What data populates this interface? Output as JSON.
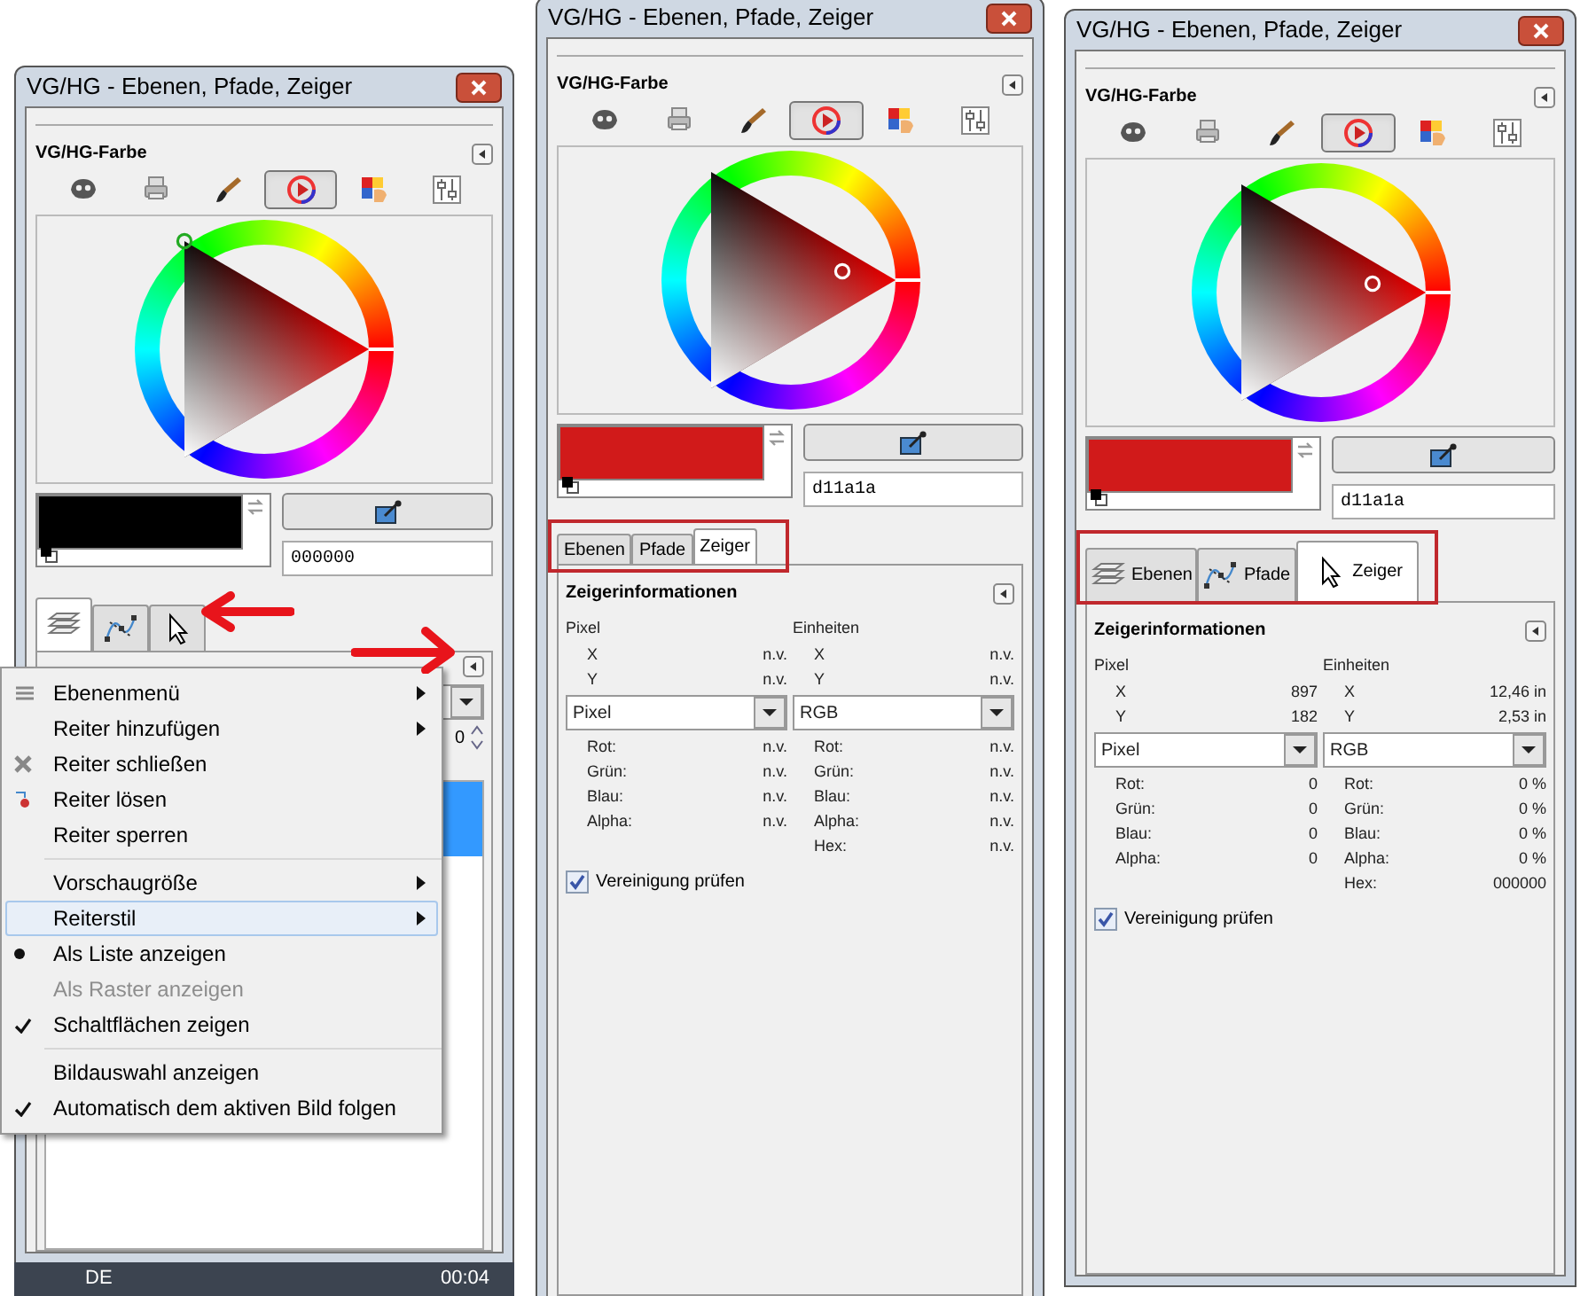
{
  "panels": [
    {
      "title": "VG/HG - Ebenen, Pfade, Zeiger",
      "dock_title": "VG/HG-Farbe",
      "color_modes": [
        {
          "selected": false
        },
        {
          "selected": false
        },
        {
          "selected": false
        },
        {
          "selected": true
        },
        {
          "selected": false
        },
        {
          "selected": false
        }
      ],
      "hex": "000000",
      "tabs": [
        {
          "kind": "icon",
          "selected": true
        },
        {
          "kind": "icon",
          "selected": false
        },
        {
          "kind": "icon",
          "selected": false
        }
      ],
      "annotation_arrows": true,
      "layers_dock": {
        "value": "0"
      },
      "menu": {
        "groups": [
          [
            {
              "label": "Ebenenmenü",
              "kind": "submenu",
              "selected": false,
              "disabled": false
            },
            {
              "label": "Reiter hinzufügen",
              "kind": "submenu",
              "selected": false,
              "disabled": false
            },
            {
              "label": "Reiter schließen",
              "kind": "action",
              "selected": false,
              "disabled": false
            },
            {
              "label": "Reiter lösen",
              "kind": "action",
              "selected": false,
              "disabled": false
            },
            {
              "label": "Reiter sperren",
              "kind": "action",
              "selected": false,
              "disabled": false
            }
          ],
          [
            {
              "label": "Vorschaugröße",
              "kind": "submenu",
              "selected": false,
              "disabled": false
            },
            {
              "label": "Reiterstil",
              "kind": "submenu",
              "selected": true,
              "disabled": false
            },
            {
              "label": "Als Liste anzeigen",
              "kind": "radio",
              "checked": true,
              "selected": false,
              "disabled": false
            },
            {
              "label": "Als Raster anzeigen",
              "kind": "radio",
              "checked": false,
              "selected": false,
              "disabled": true
            },
            {
              "label": "Schaltflächen zeigen",
              "kind": "check",
              "checked": true,
              "selected": false,
              "disabled": false
            }
          ],
          [
            {
              "label": "Bildauswahl anzeigen",
              "kind": "check",
              "checked": false,
              "selected": false,
              "disabled": false
            },
            {
              "label": "Automatisch dem aktiven Bild folgen",
              "kind": "check",
              "checked": true,
              "selected": false,
              "disabled": false
            }
          ]
        ]
      },
      "taskbar": {
        "language": "DE",
        "clock": "00:04"
      }
    },
    {
      "title": "VG/HG - Ebenen, Pfade, Zeiger",
      "dock_title": "VG/HG-Farbe",
      "color_modes": [
        {
          "selected": false
        },
        {
          "selected": false
        },
        {
          "selected": false
        },
        {
          "selected": true
        },
        {
          "selected": false
        },
        {
          "selected": false
        }
      ],
      "hex": "d11a1a",
      "tabs": [
        {
          "kind": "text",
          "label": "Ebenen",
          "selected": false
        },
        {
          "kind": "text",
          "label": "Pfade",
          "selected": false
        },
        {
          "kind": "text",
          "label": "Zeiger",
          "selected": true
        }
      ],
      "tabs_highlighted": true,
      "pointer_info": {
        "title": "Zeigerinformationen",
        "left": {
          "heading": "Pixel",
          "coords": [
            {
              "label": "X",
              "value": "n.v."
            },
            {
              "label": "Y",
              "value": "n.v."
            }
          ],
          "mode": "Pixel",
          "channels": [
            {
              "label": "Rot:",
              "value": "n.v."
            },
            {
              "label": "Grün:",
              "value": "n.v."
            },
            {
              "label": "Blau:",
              "value": "n.v."
            },
            {
              "label": "Alpha:",
              "value": "n.v."
            }
          ]
        },
        "right": {
          "heading": "Einheiten",
          "coords": [
            {
              "label": "X",
              "value": "n.v."
            },
            {
              "label": "Y",
              "value": "n.v."
            }
          ],
          "mode": "RGB",
          "channels": [
            {
              "label": "Rot:",
              "value": "n.v."
            },
            {
              "label": "Grün:",
              "value": "n.v."
            },
            {
              "label": "Blau:",
              "value": "n.v."
            },
            {
              "label": "Alpha:",
              "value": "n.v."
            },
            {
              "label": "Hex:",
              "value": "n.v."
            }
          ]
        },
        "checkbox": {
          "label": "Vereinigung prüfen",
          "checked": true
        }
      }
    },
    {
      "title": "VG/HG - Ebenen, Pfade, Zeiger",
      "dock_title": "VG/HG-Farbe",
      "color_modes": [
        {
          "selected": false
        },
        {
          "selected": false
        },
        {
          "selected": false
        },
        {
          "selected": true
        },
        {
          "selected": false
        },
        {
          "selected": false
        }
      ],
      "hex": "d11a1a",
      "tabs": [
        {
          "kind": "icon-text",
          "label": "Ebenen",
          "selected": false
        },
        {
          "kind": "icon-text",
          "label": "Pfade",
          "selected": false
        },
        {
          "kind": "icon-text",
          "label": "Zeiger",
          "selected": true
        }
      ],
      "tabs_highlighted": true,
      "pointer_info": {
        "title": "Zeigerinformationen",
        "left": {
          "heading": "Pixel",
          "coords": [
            {
              "label": "X",
              "value": "897"
            },
            {
              "label": "Y",
              "value": "182"
            }
          ],
          "mode": "Pixel",
          "channels": [
            {
              "label": "Rot:",
              "value": "0"
            },
            {
              "label": "Grün:",
              "value": "0"
            },
            {
              "label": "Blau:",
              "value": "0"
            },
            {
              "label": "Alpha:",
              "value": "0"
            }
          ]
        },
        "right": {
          "heading": "Einheiten",
          "coords": [
            {
              "label": "X",
              "value": "12,46 in"
            },
            {
              "label": "Y",
              "value": "2,53 in"
            }
          ],
          "mode": "RGB",
          "channels": [
            {
              "label": "Rot:",
              "value": "0 %"
            },
            {
              "label": "Grün:",
              "value": "0 %"
            },
            {
              "label": "Blau:",
              "value": "0 %"
            },
            {
              "label": "Alpha:",
              "value": "0 %"
            },
            {
              "label": "Hex:",
              "value": "000000"
            }
          ]
        },
        "checkbox": {
          "label": "Vereinigung prüfen",
          "checked": true
        }
      }
    }
  ]
}
